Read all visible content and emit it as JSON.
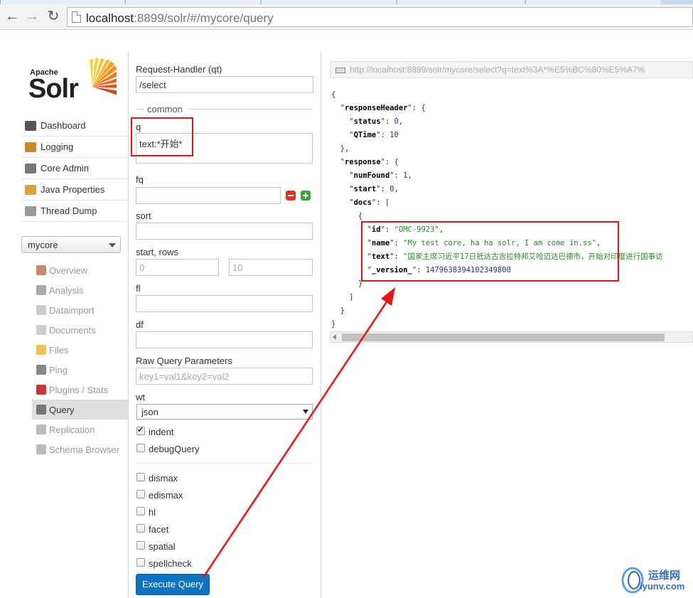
{
  "browser": {
    "url_host": "localhost",
    "url_rest": ":8899/solr/#/mycore/query"
  },
  "logo": {
    "apache": "Apache",
    "solr": "Solr"
  },
  "main_menu": [
    {
      "label": "Dashboard",
      "icon": "dashboard-icon",
      "color": "#555"
    },
    {
      "label": "Logging",
      "icon": "logging-icon",
      "color": "#c88a2a"
    },
    {
      "label": "Core Admin",
      "icon": "core-admin-icon",
      "color": "#777"
    },
    {
      "label": "Java Properties",
      "icon": "java-icon",
      "color": "#d9a33a"
    },
    {
      "label": "Thread Dump",
      "icon": "thread-dump-icon",
      "color": "#999"
    }
  ],
  "core_selector": {
    "value": "mycore"
  },
  "core_menu": [
    {
      "label": "Overview",
      "icon": "overview-icon",
      "color": "#c86"
    },
    {
      "label": "Analysis",
      "icon": "analysis-icon",
      "color": "#aaa"
    },
    {
      "label": "Dataimport",
      "icon": "dataimport-icon",
      "color": "#ccc"
    },
    {
      "label": "Documents",
      "icon": "documents-icon",
      "color": "#ccc"
    },
    {
      "label": "Files",
      "icon": "files-icon",
      "color": "#f0c050"
    },
    {
      "label": "Ping",
      "icon": "ping-icon",
      "color": "#888"
    },
    {
      "label": "Plugins / Stats",
      "icon": "plugins-icon",
      "color": "#c33"
    },
    {
      "label": "Query",
      "icon": "query-icon",
      "color": "#777"
    },
    {
      "label": "Replication",
      "icon": "replication-icon",
      "color": "#bbb"
    },
    {
      "label": "Schema Browser",
      "icon": "schema-browser-icon",
      "color": "#bbb"
    }
  ],
  "form": {
    "qt_label": "Request-Handler (qt)",
    "qt_value": "/select",
    "common_label": "common",
    "q_label": "q",
    "q_value": "text:*开始*",
    "fq_label": "fq",
    "sort_label": "sort",
    "start_rows_label": "start, rows",
    "start_placeholder": "0",
    "rows_placeholder": "10",
    "fl_label": "fl",
    "df_label": "df",
    "raw_label": "Raw Query Parameters",
    "raw_placeholder": "key1=val1&key2=val2",
    "wt_label": "wt",
    "wt_value": "json",
    "indent_label": "indent",
    "debug_label": "debugQuery",
    "dismax_label": "dismax",
    "edismax_label": "edismax",
    "hl_label": "hl",
    "facet_label": "facet",
    "spatial_label": "spatial",
    "spellcheck_label": "spellcheck",
    "execute_label": "Execute Query"
  },
  "response": {
    "url": "http://localhost:8899/solr/mycore/select?q=text%3A*%E5%BC%80%E5%A7%",
    "status": "0",
    "qtime": "10",
    "numfound": "1",
    "start": "0",
    "doc_id": "OMC-9923",
    "doc_name": "My test core, ha ha solr, I am come in.ss",
    "doc_text": "国家主席习近平17日抵达古吉拉特邦艾哈迈达巴德市，开始对印度进行国事访",
    "doc_version": "1479638394102349800"
  },
  "watermark": {
    "cn": "运维网",
    "en": "iyunv.com"
  },
  "colors": {
    "accent": "#0b75c4",
    "annotation": "#ee1111"
  }
}
